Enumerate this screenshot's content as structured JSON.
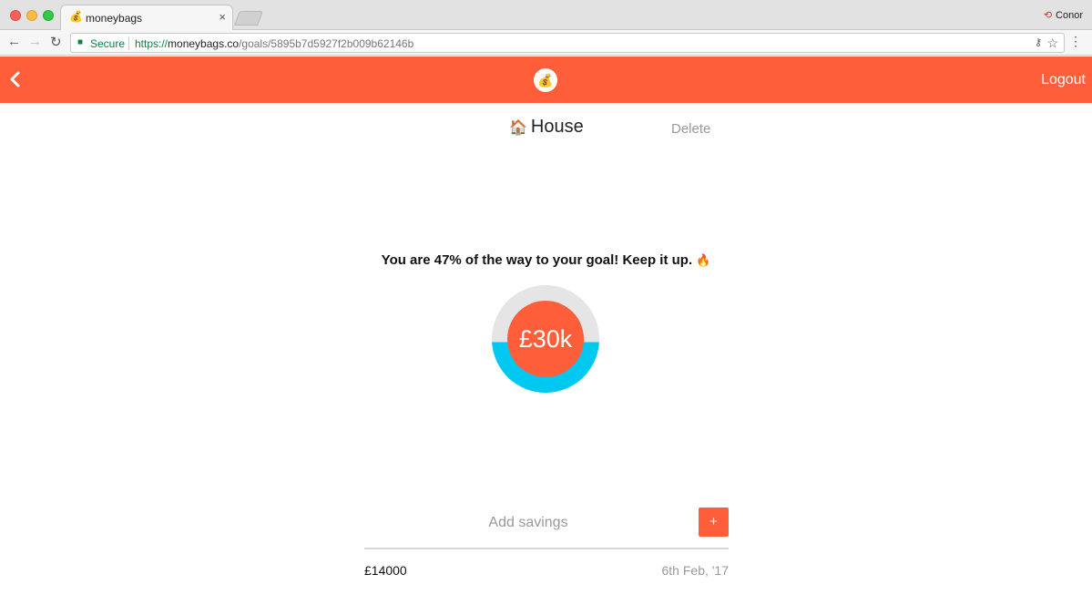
{
  "browser": {
    "tab_favicon": "💰",
    "tab_title": "moneybags",
    "tab_close": "×",
    "profile_name": "Conor",
    "secure_label": "Secure",
    "url_scheme": "https://",
    "url_host": "moneybags.co",
    "url_path": "/goals/5895b7d5927f2b009b62146b"
  },
  "header": {
    "logo_icon": "💰",
    "logout_label": "Logout",
    "background": "#ff5e3a"
  },
  "goal": {
    "icon": "🏠",
    "name": "House",
    "delete_label": "Delete",
    "progress_message": "You are 47% of the way to your goal! Keep it up.",
    "progress_emoji": "🔥",
    "progress_fraction": 0.47,
    "target_label": "£30k",
    "ring_track_color": "#e5e5e5",
    "ring_fill_color": "#00c8f0",
    "center_color": "#ff5e3a"
  },
  "savings": {
    "placeholder": "Add savings",
    "add_label": "+",
    "entries": [
      {
        "amount": "£14000",
        "date": "6th Feb, '17"
      }
    ]
  }
}
